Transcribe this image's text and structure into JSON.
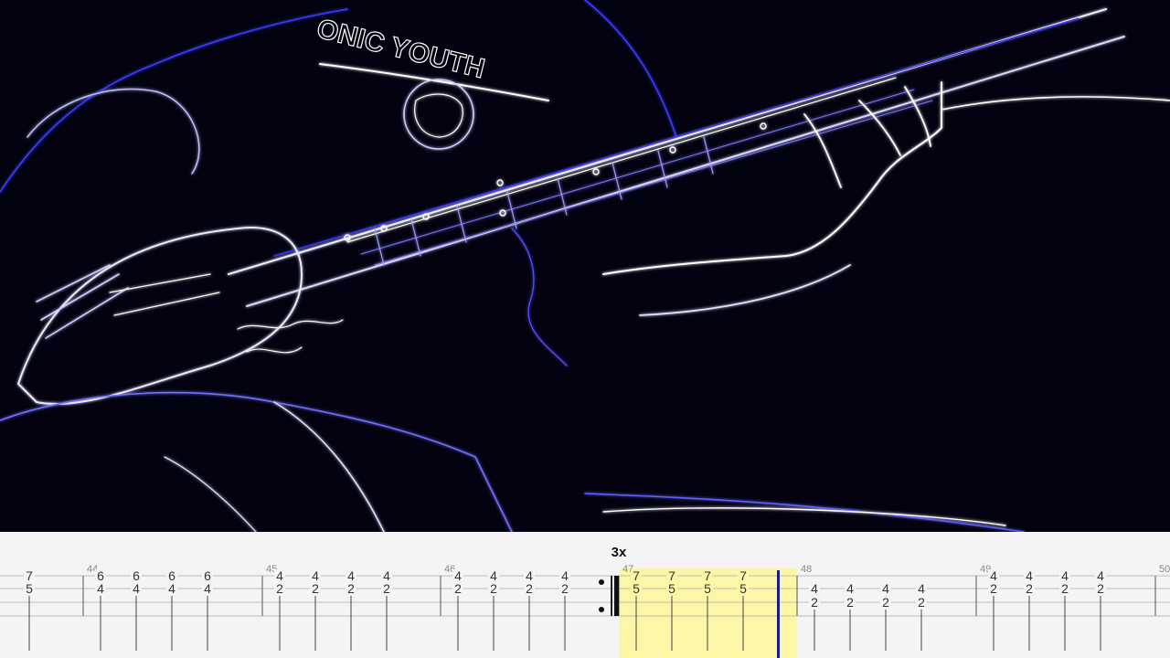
{
  "player": {
    "video_description_hidden": "",
    "repeat_label": "3x",
    "highlight_color": "#fbf7a7",
    "cursor_color": "#1b1b8f",
    "string_color": "#bdbdbd",
    "number_color": "#333333"
  },
  "video_text": {
    "shirt_text": "ONIC YOUTH"
  },
  "measures": [
    {
      "number": "",
      "notes": [
        {
          "fret": "7",
          "string": 1
        },
        {
          "fret": "5",
          "string": 2
        }
      ]
    },
    {
      "number": "44",
      "notes": [
        {
          "fret": "6",
          "string": 1
        },
        {
          "fret": "4",
          "string": 2
        },
        {
          "fret": "6",
          "string": 1
        },
        {
          "fret": "4",
          "string": 2
        },
        {
          "fret": "6",
          "string": 1
        },
        {
          "fret": "4",
          "string": 2
        },
        {
          "fret": "6",
          "string": 1
        },
        {
          "fret": "4",
          "string": 2
        }
      ]
    },
    {
      "number": "45",
      "notes": [
        {
          "fret": "4",
          "string": 1
        },
        {
          "fret": "2",
          "string": 2
        },
        {
          "fret": "4",
          "string": 1
        },
        {
          "fret": "2",
          "string": 2
        },
        {
          "fret": "4",
          "string": 1
        },
        {
          "fret": "2",
          "string": 2
        },
        {
          "fret": "4",
          "string": 1
        },
        {
          "fret": "2",
          "string": 2
        }
      ]
    },
    {
      "number": "46",
      "notes": [
        {
          "fret": "4",
          "string": 1
        },
        {
          "fret": "2",
          "string": 2
        },
        {
          "fret": "4",
          "string": 1
        },
        {
          "fret": "2",
          "string": 2
        },
        {
          "fret": "4",
          "string": 1
        },
        {
          "fret": "2",
          "string": 2
        },
        {
          "fret": "4",
          "string": 1
        },
        {
          "fret": "2",
          "string": 2
        }
      ]
    },
    {
      "number": "47",
      "notes": [
        {
          "fret": "7",
          "string": 1
        },
        {
          "fret": "5",
          "string": 2
        },
        {
          "fret": "7",
          "string": 1
        },
        {
          "fret": "5",
          "string": 2
        },
        {
          "fret": "7",
          "string": 1
        },
        {
          "fret": "5",
          "string": 2
        },
        {
          "fret": "7",
          "string": 1
        },
        {
          "fret": "5",
          "string": 2
        }
      ]
    },
    {
      "number": "48",
      "notes": [
        {
          "fret": "4",
          "string": 2
        },
        {
          "fret": "2",
          "string": 3
        },
        {
          "fret": "4",
          "string": 2
        },
        {
          "fret": "2",
          "string": 3
        },
        {
          "fret": "4",
          "string": 2
        },
        {
          "fret": "2",
          "string": 3
        },
        {
          "fret": "4",
          "string": 2
        },
        {
          "fret": "2",
          "string": 3
        }
      ]
    },
    {
      "number": "49",
      "notes": [
        {
          "fret": "4",
          "string": 1
        },
        {
          "fret": "2",
          "string": 2
        },
        {
          "fret": "4",
          "string": 1
        },
        {
          "fret": "2",
          "string": 2
        },
        {
          "fret": "4",
          "string": 1
        },
        {
          "fret": "2",
          "string": 2
        },
        {
          "fret": "4",
          "string": 1
        },
        {
          "fret": "2",
          "string": 2
        }
      ]
    },
    {
      "number": "50",
      "notes": []
    }
  ]
}
